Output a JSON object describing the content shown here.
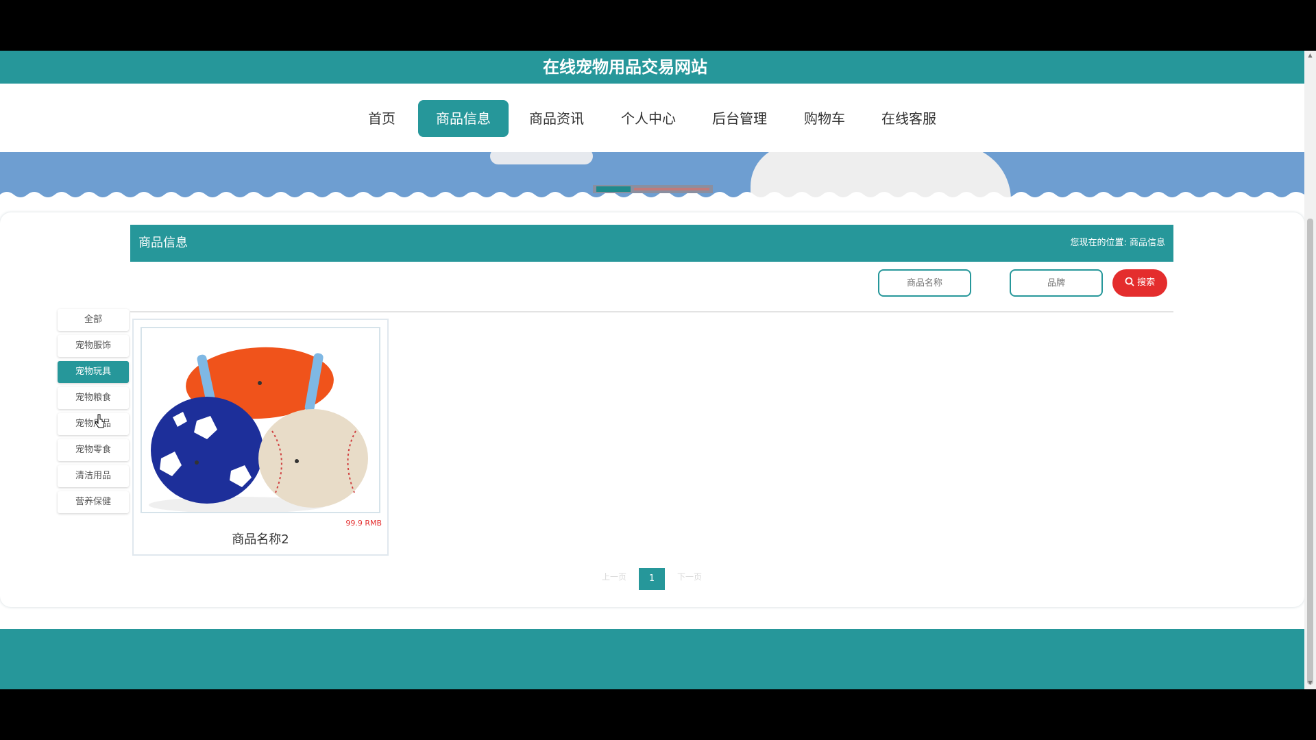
{
  "site": {
    "title": "在线宠物用品交易网站"
  },
  "nav": {
    "items": [
      {
        "label": "首页"
      },
      {
        "label": "商品信息"
      },
      {
        "label": "商品资讯"
      },
      {
        "label": "个人中心"
      },
      {
        "label": "后台管理"
      },
      {
        "label": "购物车"
      },
      {
        "label": "在线客服"
      }
    ],
    "active_index": 1
  },
  "section": {
    "title": "商品信息",
    "location_label": "您现在的位置:",
    "location_value": "商品信息"
  },
  "search": {
    "name_placeholder": "商品名称",
    "brand_placeholder": "品牌",
    "button_label": "搜索",
    "icon": "search-icon"
  },
  "categories": {
    "items": [
      {
        "label": "全部"
      },
      {
        "label": "宠物服饰"
      },
      {
        "label": "宠物玩具"
      },
      {
        "label": "宠物粮食"
      },
      {
        "label": "宠物用品"
      },
      {
        "label": "宠物零食"
      },
      {
        "label": "清洁用品"
      },
      {
        "label": "营养保健"
      }
    ],
    "active_index": 2
  },
  "products": [
    {
      "name": "商品名称2",
      "price": "99.9 RMB"
    }
  ],
  "pagination": {
    "prev": "上一页",
    "current": "1",
    "next": "下一页"
  },
  "colors": {
    "primary": "#26979a",
    "accent_red": "#e42d2d"
  }
}
